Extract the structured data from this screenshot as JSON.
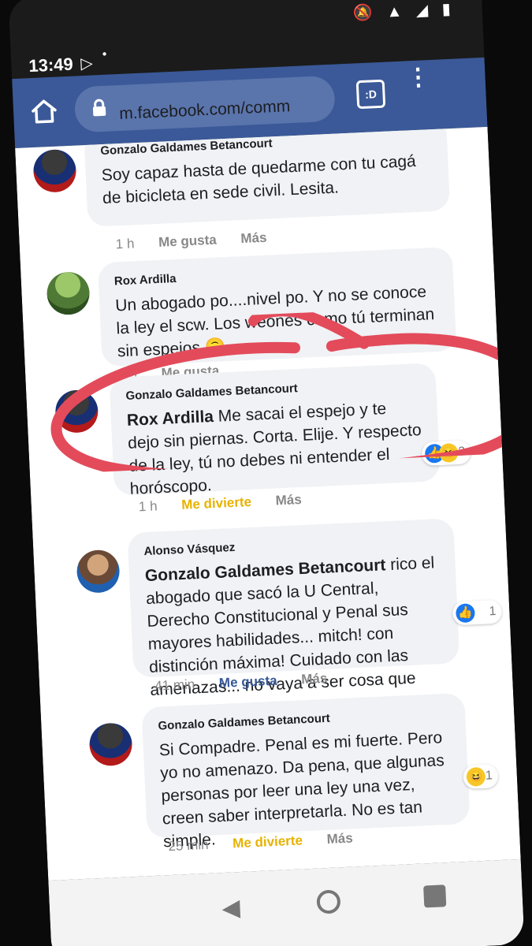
{
  "status": {
    "time": "13:49",
    "play": "▷",
    "dot": "•",
    "icons": "🔕 ▲ ◢ ▮"
  },
  "browser": {
    "url": "m.facebook.com/comm",
    "tab_count": ":D",
    "menu": "⋮",
    "home_icon": "home-icon",
    "lock_icon": "lock-icon"
  },
  "comments": [
    {
      "id": "c1",
      "author": "Gonzalo Galdames Betancourt",
      "text": "Soy capaz hasta de quedarme con tu cagá de bicicleta en sede civil. Lesita.",
      "time": "1 h",
      "actions": [
        "Me gusta",
        "Más"
      ]
    },
    {
      "id": "c2",
      "author": "Rox Ardilla",
      "text": "Un abogado po....nivel po. Y no se conoce la ley el scw. Los weones como tú terminan sin espejos 🙃",
      "time": "1 h",
      "actions": [
        "Me gusta"
      ]
    },
    {
      "id": "c3",
      "author": "Gonzalo Galdames Betancourt",
      "mention": "Rox Ardilla",
      "text": "Me sacai el espejo y te dejo sin piernas. Corta. Elije. Y respecto de la ley, tú no debes ni entender el horóscopo.",
      "time": "1 h",
      "actions": [
        "Me divierte",
        "Más"
      ],
      "reactions": {
        "count": "2"
      }
    },
    {
      "id": "c4",
      "author": "Alonso Vásquez",
      "mention": "Gonzalo Galdames Betancourt",
      "text": "rico el abogado que sacó la U Central, Derecho Constitucional y Penal sus mayores habilidades... mitch! con distinción máxima! Cuidado con las amenazas... no vaya a ser cosa que",
      "time": "41 min",
      "actions": [
        "Me gusta",
        "Más"
      ],
      "reactions": {
        "count": "1"
      }
    },
    {
      "id": "c5",
      "author": "Gonzalo Galdames Betancourt",
      "text": "Si Compadre. Penal es mi fuerte. Pero yo no amenazo. Da pena, que algunas personas por leer una ley una vez, creen saber interpretarla. No es tan simple.",
      "time": "25 min",
      "actions": [
        "Me divierte",
        "Más"
      ],
      "reactions": {
        "count": "1"
      }
    }
  ],
  "annotation": {
    "color": "#e34b5b"
  },
  "nav": {
    "back": "◀",
    "home": "home",
    "recent": "recent"
  }
}
